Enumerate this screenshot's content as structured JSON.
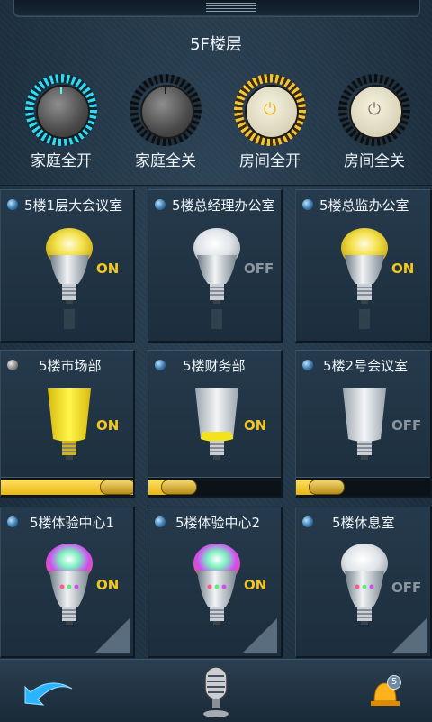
{
  "header": {
    "floor_title": "5F楼层"
  },
  "master_controls": [
    {
      "label": "家庭全开",
      "style": "cyan-ring",
      "icon": "knob-icon"
    },
    {
      "label": "家庭全关",
      "style": "dark-ring",
      "icon": "knob-icon"
    },
    {
      "label": "房间全开",
      "style": "yellow-ring",
      "icon": "power-icon"
    },
    {
      "label": "房间全关",
      "style": "dark-ring",
      "icon": "power-icon"
    }
  ],
  "power_glyph": "⏻",
  "rooms": [
    {
      "name": "5楼1层大会议室",
      "state": "ON",
      "bulb": "yellow"
    },
    {
      "name": "5楼总经理办公室",
      "state": "OFF",
      "bulb": "white"
    },
    {
      "name": "5楼总监办公室",
      "state": "ON",
      "bulb": "yellow"
    },
    {
      "name": "5楼市场部",
      "state": "ON",
      "bulb": "yellow-tube",
      "dimmer": 1.0
    },
    {
      "name": "5楼财务部",
      "state": "ON",
      "bulb": "white-tube-low",
      "dimmer": 0.0
    },
    {
      "name": "5楼2号会议室",
      "state": "OFF",
      "bulb": "white-tube",
      "dimmer": 0.0
    },
    {
      "name": "5楼体验中心1",
      "state": "ON",
      "bulb": "rgb"
    },
    {
      "name": "5楼体验中心2",
      "state": "ON",
      "bulb": "rgb"
    },
    {
      "name": "5楼休息室",
      "state": "OFF",
      "bulb": "rgb-off"
    }
  ],
  "footer": {
    "notification_count": "5"
  },
  "colors": {
    "on": "#f3c81f",
    "off": "#8c96a0",
    "accent_cyan": "#31d8f0"
  }
}
